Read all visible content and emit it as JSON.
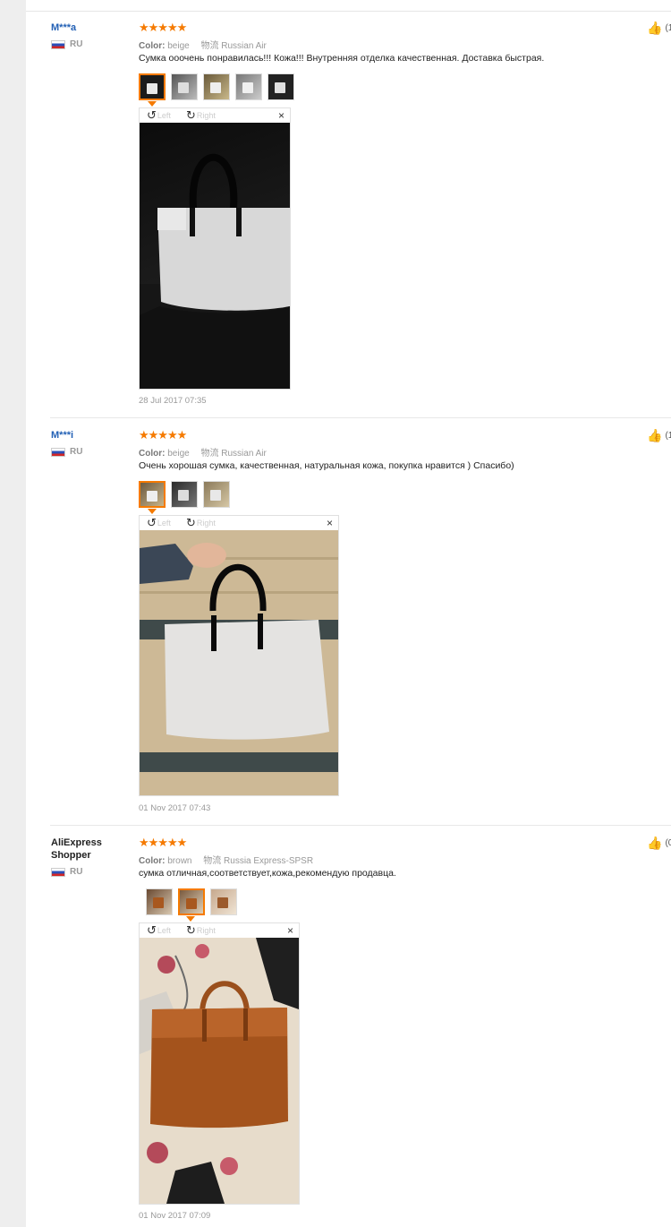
{
  "reviews": [
    {
      "user": "M***a",
      "country": "RU",
      "stars": "★★★★★",
      "color_label": "Color:",
      "color_value": "beige",
      "shipping_label": "物流",
      "shipping_value": "Russian Air",
      "comment": "Сумка ооочень понравилась!!! Кожа!!! Внутренняя отделка качественная. Доставка быстрая.",
      "rotate_left": "Left",
      "rotate_right": "Right",
      "close": "×",
      "date": "28 Jul 2017 07:35",
      "helpful": "(1"
    },
    {
      "user": "M***i",
      "country": "RU",
      "stars": "★★★★★",
      "color_label": "Color:",
      "color_value": "beige",
      "shipping_label": "物流",
      "shipping_value": "Russian Air",
      "comment": "Очень хорошая сумка, качественная, натуральная кожа, покупка нравится ) Спасибо)",
      "rotate_left": "Left",
      "rotate_right": "Right",
      "close": "×",
      "date": "01 Nov 2017 07:43",
      "helpful": "(1"
    },
    {
      "user": "AliExpress Shopper",
      "country": "RU",
      "stars": "★★★★★",
      "color_label": "Color:",
      "color_value": "brown",
      "shipping_label": "物流",
      "shipping_value": "Russia Express-SPSR",
      "comment": "сумка отличная,соответствует,кожа,рекомендую продавца.",
      "rotate_left": "Left",
      "rotate_right": "Right",
      "close": "×",
      "date": "01 Nov 2017 07:09",
      "helpful": "(0"
    }
  ],
  "icons": {
    "like": "thumbs-up-icon",
    "rotate_left": "rotate-left-icon",
    "rotate_right": "rotate-right-icon",
    "flag": "flag-ru-icon"
  },
  "colors": {
    "accent": "#f57a00",
    "username": "#2260b5"
  }
}
